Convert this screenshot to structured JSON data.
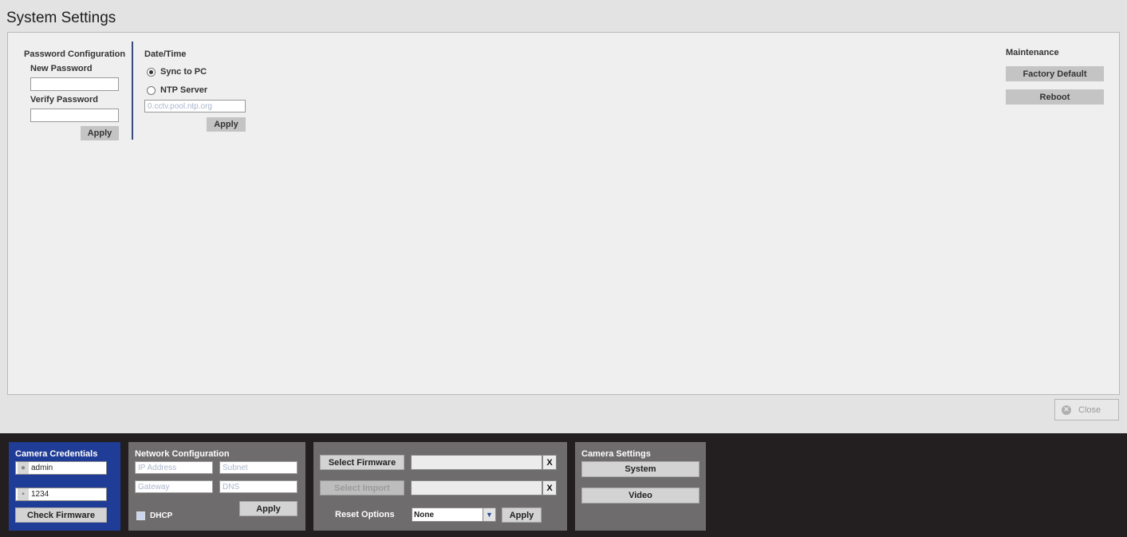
{
  "window": {
    "title": "System Settings"
  },
  "password": {
    "section_label": "Password Configuration",
    "new_label": "New Password",
    "new_value": "",
    "verify_label": "Verify Password",
    "verify_value": "",
    "apply_label": "Apply"
  },
  "datetime": {
    "section_label": "Date/Time",
    "sync_label": "Sync to PC",
    "ntp_label": "NTP Server",
    "ntp_placeholder": "0.cctv.pool.ntp.org",
    "selected": "sync",
    "apply_label": "Apply"
  },
  "maintenance": {
    "section_label": "Maintenance",
    "factory_label": "Factory Default",
    "reboot_label": "Reboot"
  },
  "close_label": "Close",
  "credentials": {
    "title": "Camera Credentials",
    "username": "admin",
    "password": "1234",
    "check_label": "Check Firmware",
    "user_icon": "user-icon",
    "lock_icon": "lock-icon"
  },
  "network": {
    "title": "Network Configuration",
    "ip_placeholder": "IP Address",
    "subnet_placeholder": "Subnet",
    "gateway_placeholder": "Gateway",
    "dns_placeholder": "DNS",
    "dhcp_label": "DHCP",
    "apply_label": "Apply"
  },
  "firmware": {
    "select_firmware_label": "Select Firmware",
    "select_import_label": "Select Import",
    "clear_label": "X",
    "reset_options_label": "Reset Options",
    "reset_value": "None",
    "apply_label": "Apply"
  },
  "camera_settings": {
    "title": "Camera Settings",
    "system_label": "System",
    "video_label": "Video"
  },
  "colors": {
    "credentials_bg": "#1f3c96",
    "panel_bg": "#6e6c6d",
    "bottom_bar_bg": "#231f20"
  }
}
